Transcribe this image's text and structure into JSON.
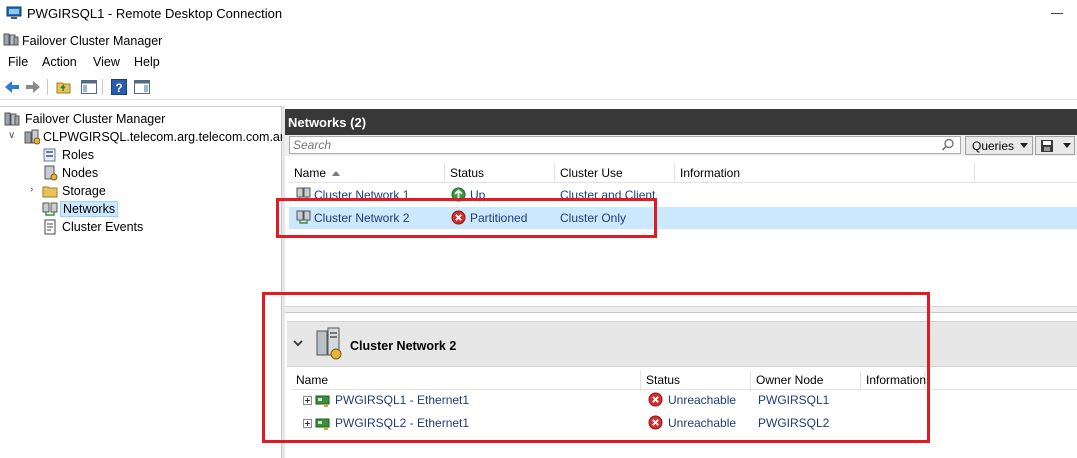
{
  "rdp": {
    "title": "PWGIRSQL1 - Remote Desktop Connection"
  },
  "app": {
    "title": "Failover Cluster Manager"
  },
  "menu": [
    "File",
    "Action",
    "View",
    "Help"
  ],
  "toolbar": {
    "icons": [
      "back-arrow-icon",
      "forward-arrow-icon",
      "up-folder-icon",
      "show-hide-tree-icon",
      "help-icon",
      "action-pane-icon"
    ]
  },
  "tree": {
    "root": "Failover Cluster Manager",
    "cluster": "CLPWGIRSQL.telecom.arg.telecom.com.ar",
    "items": [
      {
        "label": "Roles",
        "icon": "roles-icon"
      },
      {
        "label": "Nodes",
        "icon": "nodes-icon"
      },
      {
        "label": "Storage",
        "icon": "storage-folder-icon",
        "expandable": true
      },
      {
        "label": "Networks",
        "icon": "networks-icon",
        "selected": true
      },
      {
        "label": "Cluster Events",
        "icon": "cluster-events-icon"
      }
    ]
  },
  "networks": {
    "header": "Networks (2)",
    "search_placeholder": "Search",
    "queries_label": "Queries",
    "columns": [
      "Name",
      "Status",
      "Cluster Use",
      "Information"
    ],
    "rows": [
      {
        "name": "Cluster Network 1",
        "status": "Up",
        "status_kind": "up",
        "cluster_use": "Cluster and Client",
        "information": ""
      },
      {
        "name": "Cluster Network 2",
        "status": "Partitioned",
        "status_kind": "error",
        "cluster_use": "Cluster Only",
        "information": "",
        "selected": true
      }
    ]
  },
  "detail": {
    "title": "Cluster Network 2",
    "columns": [
      "Name",
      "Status",
      "Owner Node",
      "Information"
    ],
    "rows": [
      {
        "name": "PWGIRSQL1 - Ethernet1",
        "status": "Unreachable",
        "owner": "PWGIRSQL1",
        "information": ""
      },
      {
        "name": "PWGIRSQL2 - Ethernet1",
        "status": "Unreachable",
        "owner": "PWGIRSQL2",
        "information": ""
      }
    ]
  },
  "colors": {
    "header_bg": "#383838",
    "selection": "#cce8ff",
    "annotation": "#e21b23",
    "link_text": "#1e3c78",
    "error_red": "#d32f2f",
    "up_green": "#2e9b3a"
  }
}
